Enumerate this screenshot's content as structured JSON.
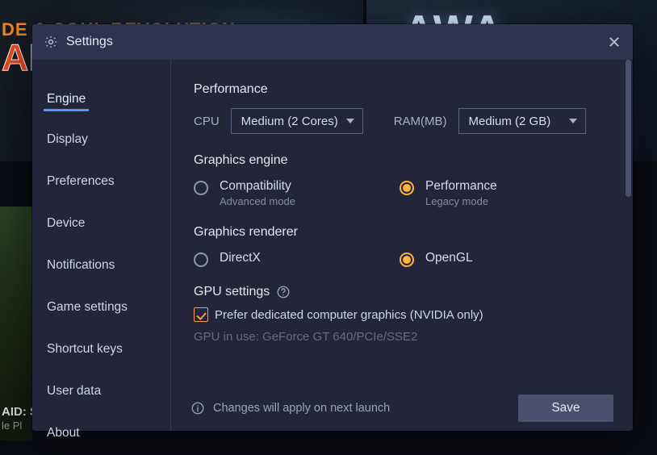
{
  "background": {
    "tile1_line1": "DE & SOUL REVOLUTION",
    "tile1_line2": "AN",
    "tile2_text": "AWA",
    "tile3_line1": "AID: S",
    "tile3_line2": "le Pl"
  },
  "modal": {
    "title": "Settings"
  },
  "sidebar": {
    "items": [
      {
        "label": "Engine",
        "active": true
      },
      {
        "label": "Display"
      },
      {
        "label": "Preferences"
      },
      {
        "label": "Device"
      },
      {
        "label": "Notifications"
      },
      {
        "label": "Game settings"
      },
      {
        "label": "Shortcut keys"
      },
      {
        "label": "User data"
      },
      {
        "label": "About"
      }
    ]
  },
  "performance": {
    "heading": "Performance",
    "cpu_label": "CPU",
    "cpu_value": "Medium (2 Cores)",
    "ram_label": "RAM(MB)",
    "ram_value": "Medium (2 GB)"
  },
  "graphics_engine": {
    "heading": "Graphics engine",
    "options": [
      {
        "label": "Compatibility",
        "sub": "Advanced mode",
        "selected": false
      },
      {
        "label": "Performance",
        "sub": "Legacy mode",
        "selected": true
      }
    ]
  },
  "graphics_renderer": {
    "heading": "Graphics renderer",
    "options": [
      {
        "label": "DirectX",
        "selected": false
      },
      {
        "label": "OpenGL",
        "selected": true
      }
    ]
  },
  "gpu": {
    "heading": "GPU settings",
    "checkbox_label": "Prefer dedicated computer graphics (NVIDIA only)",
    "checked": true,
    "info": "GPU in use: GeForce GT 640/PCIe/SSE2"
  },
  "footer": {
    "note": "Changes will apply on next launch",
    "save": "Save"
  }
}
